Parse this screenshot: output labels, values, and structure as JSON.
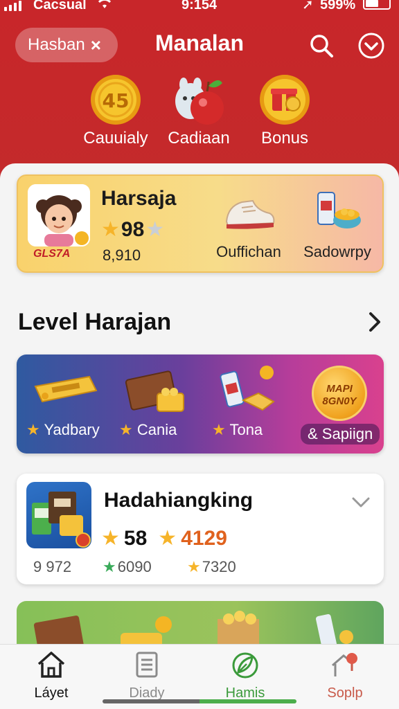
{
  "status_bar": {
    "carrier": "Cacsual",
    "time": "9:154",
    "battery": "599%"
  },
  "header": {
    "chip_label": "Hasban",
    "chip_close": "×",
    "title": "Manalan",
    "categories": [
      {
        "label": "Cauuialy",
        "coin_text": "45",
        "icon": "coin-icon"
      },
      {
        "label": "Cadiaan",
        "icon": "apple-character-icon"
      },
      {
        "label": "Bonus",
        "icon": "gift-coin-icon"
      }
    ]
  },
  "profile": {
    "name": "Harsaja",
    "stars_value": "98",
    "number": "8,910",
    "avatar_tag": "GLS7A",
    "items": [
      {
        "label": "Ouffichan",
        "icon": "sneaker-icon"
      },
      {
        "label": "Sadowrpy",
        "icon": "snack-cup-icon"
      }
    ]
  },
  "section": {
    "title": "Level Harajan"
  },
  "promo": {
    "items": [
      {
        "label": "Yadbary",
        "icon": "ticket-icon"
      },
      {
        "label": "Cania",
        "icon": "chocolate-bar-icon"
      },
      {
        "label": "Tona",
        "icon": "can-snack-icon"
      }
    ],
    "badge_text": "MAPI 8GN0Y",
    "pill_label": "& Sapiign"
  },
  "card2": {
    "name": "Hadahiangking",
    "stars_value": "58",
    "highlight_value": "4129",
    "stats": [
      "9 972",
      "6090",
      "7320"
    ]
  },
  "tabbar": {
    "tabs": [
      {
        "label": "Láyet",
        "icon": "home-icon",
        "color": "#111111"
      },
      {
        "label": "Diady",
        "icon": "document-icon",
        "color": "#8a8a8a"
      },
      {
        "label": "Hamis",
        "icon": "leaf-icon",
        "color": "#3a9a3a"
      },
      {
        "label": "Soplp",
        "icon": "house-pin-icon",
        "color": "#c85a4a"
      }
    ]
  },
  "colors": {
    "header_red": "#c8262a",
    "accent_green": "#3a9a3a",
    "star_gold": "#f6b42a",
    "highlight_orange": "#e0621e"
  }
}
